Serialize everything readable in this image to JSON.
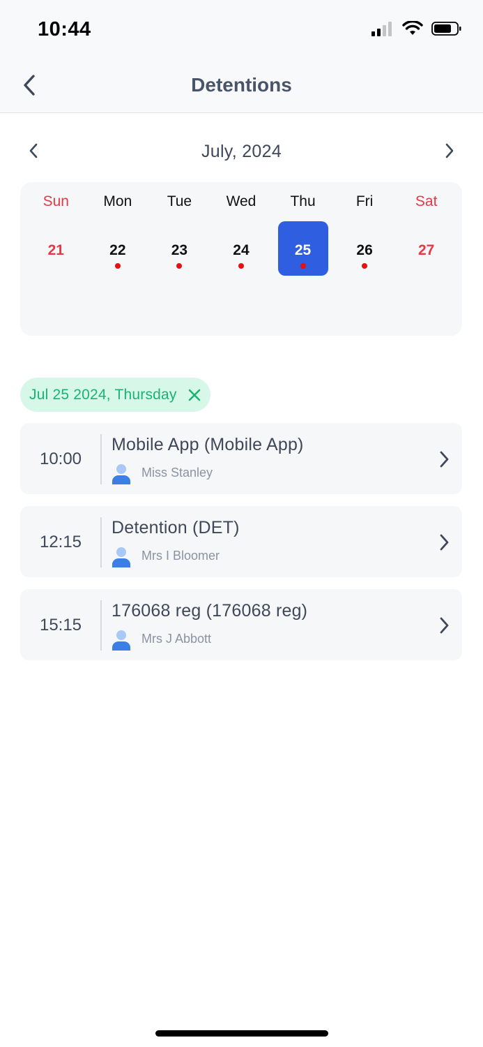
{
  "status_bar": {
    "time": "10:44"
  },
  "nav": {
    "title": "Detentions"
  },
  "calendar": {
    "month_label": "July, 2024",
    "weekdays": [
      "Sun",
      "Mon",
      "Tue",
      "Wed",
      "Thu",
      "Fri",
      "Sat"
    ],
    "dates": [
      {
        "day": "21",
        "weekend": true,
        "has_event": false,
        "selected": false
      },
      {
        "day": "22",
        "weekend": false,
        "has_event": true,
        "selected": false
      },
      {
        "day": "23",
        "weekend": false,
        "has_event": true,
        "selected": false
      },
      {
        "day": "24",
        "weekend": false,
        "has_event": true,
        "selected": false
      },
      {
        "day": "25",
        "weekend": false,
        "has_event": true,
        "selected": true
      },
      {
        "day": "26",
        "weekend": false,
        "has_event": true,
        "selected": false
      },
      {
        "day": "27",
        "weekend": true,
        "has_event": false,
        "selected": false
      }
    ]
  },
  "filter_chip": {
    "label": "Jul 25 2024, Thursday"
  },
  "sessions": [
    {
      "time": "10:00",
      "title": "Mobile App (Mobile App)",
      "teacher": "Miss Stanley"
    },
    {
      "time": "12:15",
      "title": "Detention (DET)",
      "teacher": "Mrs I Bloomer"
    },
    {
      "time": "15:15",
      "title": "176068 reg (176068 reg)",
      "teacher": "Mrs J Abbott"
    }
  ],
  "colors": {
    "accent": "#2f5fe0",
    "weekend": "#e53945",
    "event_dot": "#e81010",
    "chip_bg": "#d7f8e8",
    "chip_text": "#19b374",
    "person_icon": "#3b7fe6"
  }
}
